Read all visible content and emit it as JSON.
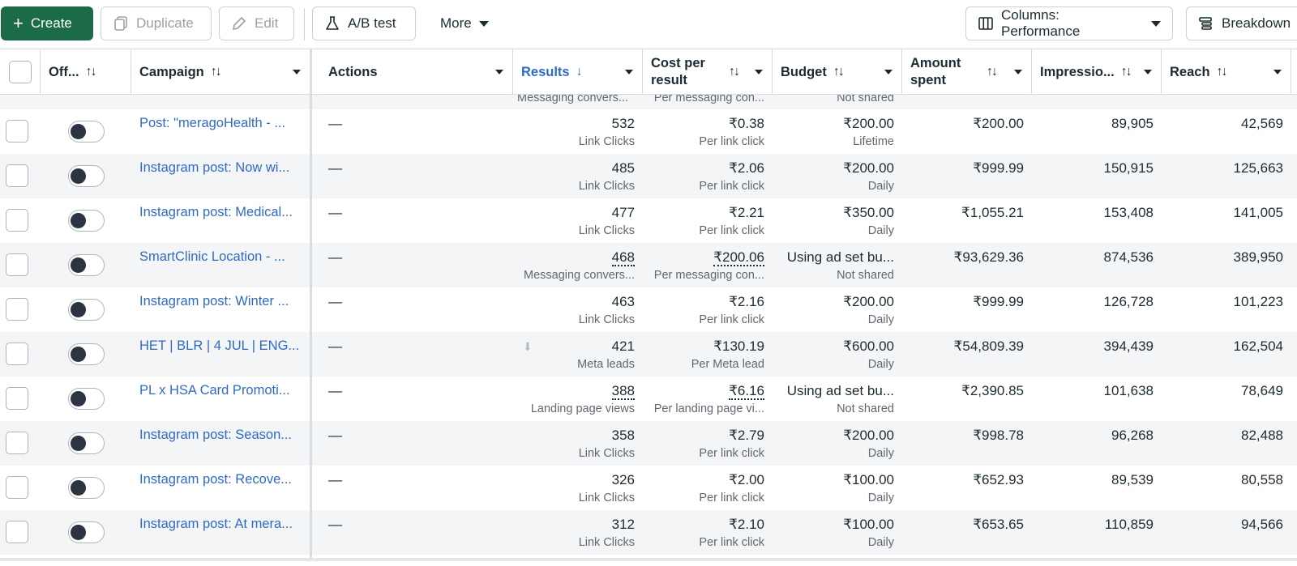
{
  "toolbar": {
    "create": "Create",
    "duplicate": "Duplicate",
    "edit": "Edit",
    "ab_test": "A/B test",
    "more": "More",
    "columns": "Columns: Performance",
    "breakdown": "Breakdown"
  },
  "header": {
    "off": "Off...",
    "campaign": "Campaign",
    "actions": "Actions",
    "results": "Results",
    "cost_per_result": "Cost per result",
    "budget": "Budget",
    "amount_spent": "Amount spent",
    "impressions": "Impressio...",
    "reach": "Reach"
  },
  "partial_row": {
    "results_sub": "Messaging convers...",
    "cost_sub": "Per messaging con...",
    "budget_sub": "Not shared"
  },
  "rows": [
    {
      "campaign": "Post: \"meragoHealth - ...",
      "actions": "—",
      "results": "532",
      "results_sub": "Link Clicks",
      "cost": "₹0.38",
      "cost_sub": "Per link click",
      "budget": "₹200.00",
      "budget_sub": "Lifetime",
      "spent": "₹200.00",
      "impressions": "89,905",
      "reach": "42,569"
    },
    {
      "campaign": "Instagram post: Now wi...",
      "actions": "—",
      "results": "485",
      "results_sub": "Link Clicks",
      "cost": "₹2.06",
      "cost_sub": "Per link click",
      "budget": "₹200.00",
      "budget_sub": "Daily",
      "spent": "₹999.99",
      "impressions": "150,915",
      "reach": "125,663"
    },
    {
      "campaign": "Instagram post: Medical...",
      "actions": "—",
      "results": "477",
      "results_sub": "Link Clicks",
      "cost": "₹2.21",
      "cost_sub": "Per link click",
      "budget": "₹350.00",
      "budget_sub": "Daily",
      "spent": "₹1,055.21",
      "impressions": "153,408",
      "reach": "141,005"
    },
    {
      "campaign": "SmartClinic Location - ...",
      "actions": "—",
      "results": "468",
      "results_sub": "Messaging convers...",
      "cost": "₹200.06",
      "cost_sub": "Per messaging con...",
      "budget": "Using ad set bu...",
      "budget_sub": "Not shared",
      "spent": "₹93,629.36",
      "impressions": "874,536",
      "reach": "389,950"
    },
    {
      "campaign": "Instagram post: Winter ...",
      "actions": "—",
      "results": "463",
      "results_sub": "Link Clicks",
      "cost": "₹2.16",
      "cost_sub": "Per link click",
      "budget": "₹200.00",
      "budget_sub": "Daily",
      "spent": "₹999.99",
      "impressions": "126,728",
      "reach": "101,223"
    },
    {
      "campaign": "HET | BLR | 4 JUL | ENG...",
      "actions": "—",
      "results": "421",
      "results_sub": "Meta leads",
      "cost": "₹130.19",
      "cost_sub": "Per Meta lead",
      "budget": "₹600.00",
      "budget_sub": "Daily",
      "spent": "₹54,809.39",
      "impressions": "394,439",
      "reach": "162,504"
    },
    {
      "campaign": "PL x HSA Card Promoti...",
      "actions": "—",
      "results": "388",
      "results_sub": "Landing page views",
      "cost": "₹6.16",
      "cost_sub": "Per landing page vi...",
      "budget": "Using ad set bu...",
      "budget_sub": "Not shared",
      "spent": "₹2,390.85",
      "impressions": "101,638",
      "reach": "78,649"
    },
    {
      "campaign": "Instagram post: Season...",
      "actions": "—",
      "results": "358",
      "results_sub": "Link Clicks",
      "cost": "₹2.79",
      "cost_sub": "Per link click",
      "budget": "₹200.00",
      "budget_sub": "Daily",
      "spent": "₹998.78",
      "impressions": "96,268",
      "reach": "82,488"
    },
    {
      "campaign": "Instagram post: Recove...",
      "actions": "—",
      "results": "326",
      "results_sub": "Link Clicks",
      "cost": "₹2.00",
      "cost_sub": "Per link click",
      "budget": "₹100.00",
      "budget_sub": "Daily",
      "spent": "₹652.93",
      "impressions": "89,539",
      "reach": "80,558"
    },
    {
      "campaign": "Instagram post: At mera...",
      "actions": "—",
      "results": "312",
      "results_sub": "Link Clicks",
      "cost": "₹2.10",
      "cost_sub": "Per link click",
      "budget": "₹100.00",
      "budget_sub": "Daily",
      "spent": "₹653.65",
      "impressions": "110,859",
      "reach": "94,566"
    }
  ]
}
